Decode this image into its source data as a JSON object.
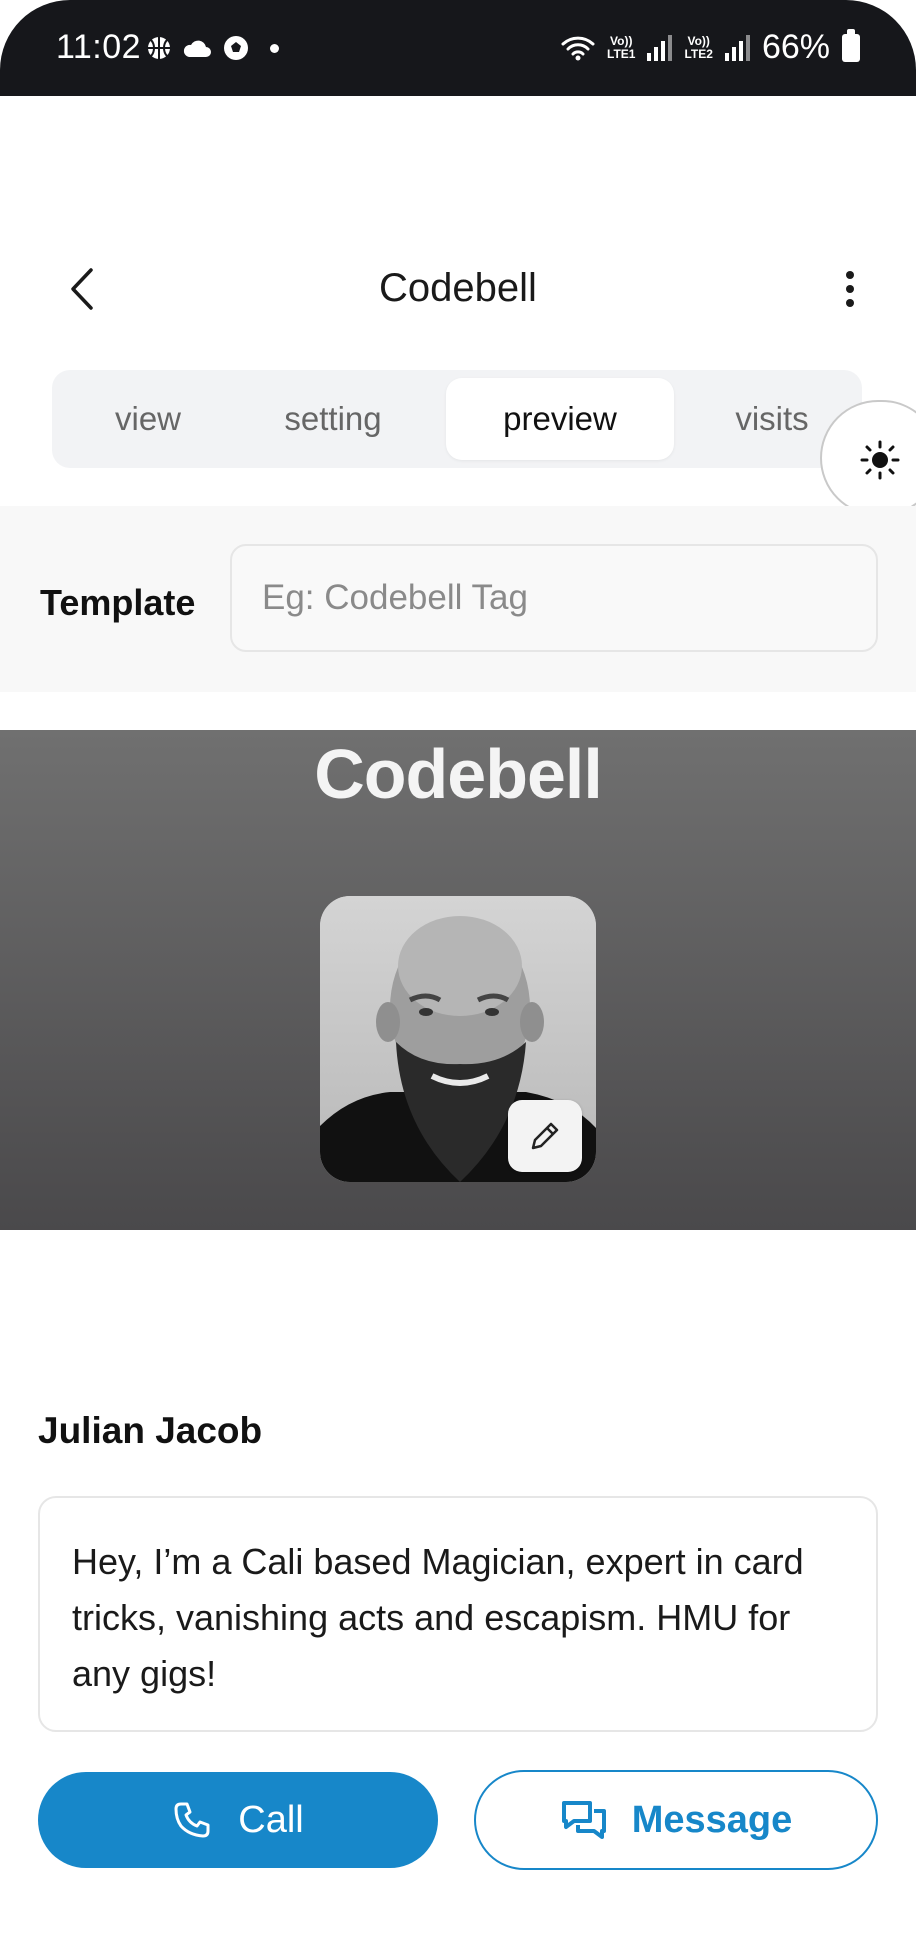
{
  "status_bar": {
    "time": "11:02",
    "battery": "66%",
    "sim1": "Vo)) LTE1",
    "sim2": "Vo)) LTE2"
  },
  "header": {
    "title": "Codebell",
    "back_icon": "chevron-left-icon",
    "menu_icon": "more-vertical-icon"
  },
  "tabs": [
    {
      "label": "view",
      "active": false
    },
    {
      "label": "setting",
      "active": false
    },
    {
      "label": "preview",
      "active": true
    },
    {
      "label": "visits",
      "active": false
    }
  ],
  "theme_toggle": {
    "icon": "sun-icon"
  },
  "template": {
    "label": "Template",
    "placeholder": "Eg: Codebell Tag",
    "value": ""
  },
  "card": {
    "brand": "Codebell",
    "avatar_icon": "profile-photo",
    "edit_icon": "pencil-icon"
  },
  "profile": {
    "name": "Julian Jacob",
    "bio": "Hey, I’m a Cali based Magician, expert in card tricks, vanishing acts and escapism. HMU for any gigs!"
  },
  "actions": {
    "call_label": "Call",
    "message_label": "Message"
  },
  "colors": {
    "accent": "#1787c9",
    "status_bar": "#16171b",
    "hero_top": "#707070",
    "hero_bottom": "#4a494b"
  }
}
